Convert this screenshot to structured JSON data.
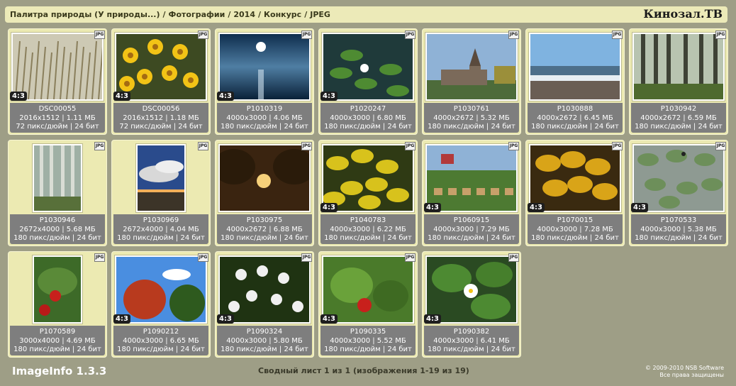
{
  "header": {
    "breadcrumb": [
      "Палитра природы (У природы...)",
      "Фотографии",
      "2014",
      "Конкурс",
      "JPEG"
    ],
    "brand": "Кинозал.ТВ"
  },
  "icons": {
    "jpg_badge": "JPG"
  },
  "images": [
    {
      "name": "DSC00055",
      "dims": "2016x1512",
      "size": "1.11 МБ",
      "res": "72 пикс/дюйм",
      "bits": "24 бит",
      "ratio": "4:3",
      "orient": "land",
      "scene": "wheat"
    },
    {
      "name": "DSC00056",
      "dims": "2016x1512",
      "size": "1.18 МБ",
      "res": "72 пикс/дюйм",
      "bits": "24 бит",
      "ratio": "4:3",
      "orient": "land",
      "scene": "flowers-yellow"
    },
    {
      "name": "P1010319",
      "dims": "4000x3000",
      "size": "4.06 МБ",
      "res": "180 пикс/дюйм",
      "bits": "24 бит",
      "ratio": "4:3",
      "orient": "land",
      "scene": "sun-sea"
    },
    {
      "name": "P1020247",
      "dims": "4000x3000",
      "size": "6.80 МБ",
      "res": "180 пикс/дюйм",
      "bits": "24 бит",
      "ratio": "4:3",
      "orient": "land",
      "scene": "lily-pond"
    },
    {
      "name": "P1030761",
      "dims": "4000x2672",
      "size": "5.32 МБ",
      "res": "180 пикс/дюйм",
      "bits": "24 бит",
      "ratio": "",
      "orient": "land",
      "scene": "church"
    },
    {
      "name": "P1030888",
      "dims": "4000x2672",
      "size": "6.45 МБ",
      "res": "180 пикс/дюйм",
      "bits": "24 бит",
      "ratio": "",
      "orient": "land",
      "scene": "shore"
    },
    {
      "name": "P1030942",
      "dims": "4000x2672",
      "size": "6.59 МБ",
      "res": "180 пикс/дюйм",
      "bits": "24 бит",
      "ratio": "",
      "orient": "land",
      "scene": "forest"
    },
    {
      "name": "P1030946",
      "dims": "2672x4000",
      "size": "5.68 МБ",
      "res": "180 пикс/дюйм",
      "bits": "24 бит",
      "ratio": "",
      "orient": "port",
      "scene": "birch"
    },
    {
      "name": "P1030969",
      "dims": "2672x4000",
      "size": "4.04 МБ",
      "res": "180 пикс/дюйм",
      "bits": "24 бит",
      "ratio": "",
      "orient": "port",
      "scene": "clouds-beach"
    },
    {
      "name": "P1030975",
      "dims": "4000x2672",
      "size": "6.88 МБ",
      "res": "180 пикс/дюйм",
      "bits": "24 бит",
      "ratio": "",
      "orient": "land",
      "scene": "sunset-trees"
    },
    {
      "name": "P1040783",
      "dims": "4000x3000",
      "size": "6.22 МБ",
      "res": "180 пикс/дюйм",
      "bits": "24 бит",
      "ratio": "4:3",
      "orient": "land",
      "scene": "yellow-leaves"
    },
    {
      "name": "P1060915",
      "dims": "4000x3000",
      "size": "7.29 МБ",
      "res": "180 пикс/дюйм",
      "bits": "24 бит",
      "ratio": "4:3",
      "orient": "land",
      "scene": "fair"
    },
    {
      "name": "P1070015",
      "dims": "4000x3000",
      "size": "7.28 МБ",
      "res": "180 пикс/дюйм",
      "bits": "24 бит",
      "ratio": "4:3",
      "orient": "land",
      "scene": "autumn-maple"
    },
    {
      "name": "P1070533",
      "dims": "4000x3000",
      "size": "5.38 МБ",
      "res": "180 пикс/дюйм",
      "bits": "24 бит",
      "ratio": "4:3",
      "orient": "land",
      "scene": "lily-pads-grey"
    },
    {
      "name": "P1070589",
      "dims": "3000x4000",
      "size": "4.69 МБ",
      "res": "180 пикс/дюйм",
      "bits": "24 бит",
      "ratio": "",
      "orient": "port",
      "scene": "cherries"
    },
    {
      "name": "P1090212",
      "dims": "4000x3000",
      "size": "6.65 МБ",
      "res": "180 пикс/дюйм",
      "bits": "24 бит",
      "ratio": "4:3",
      "orient": "land",
      "scene": "red-tree"
    },
    {
      "name": "P1090324",
      "dims": "4000x3000",
      "size": "5.80 МБ",
      "res": "180 пикс/дюйм",
      "bits": "24 бит",
      "ratio": "4:3",
      "orient": "land",
      "scene": "white-flowers"
    },
    {
      "name": "P1090335",
      "dims": "4000x3000",
      "size": "5.52 МБ",
      "res": "180 пикс/дюйм",
      "bits": "24 бит",
      "ratio": "4:3",
      "orient": "land",
      "scene": "strawberry"
    },
    {
      "name": "P1090382",
      "dims": "4000x3000",
      "size": "6.41 МБ",
      "res": "180 пикс/дюйм",
      "bits": "24 бит",
      "ratio": "4:3",
      "orient": "land",
      "scene": "water-lily"
    }
  ],
  "footer": {
    "app_name": "ImageInfo 1.3.3",
    "summary": "Сводный лист 1 из 1 (изображения 1-19 из 19)",
    "copyright_line1": "© 2009-2010 NSB Software",
    "copyright_line2": "Все права защищены"
  }
}
